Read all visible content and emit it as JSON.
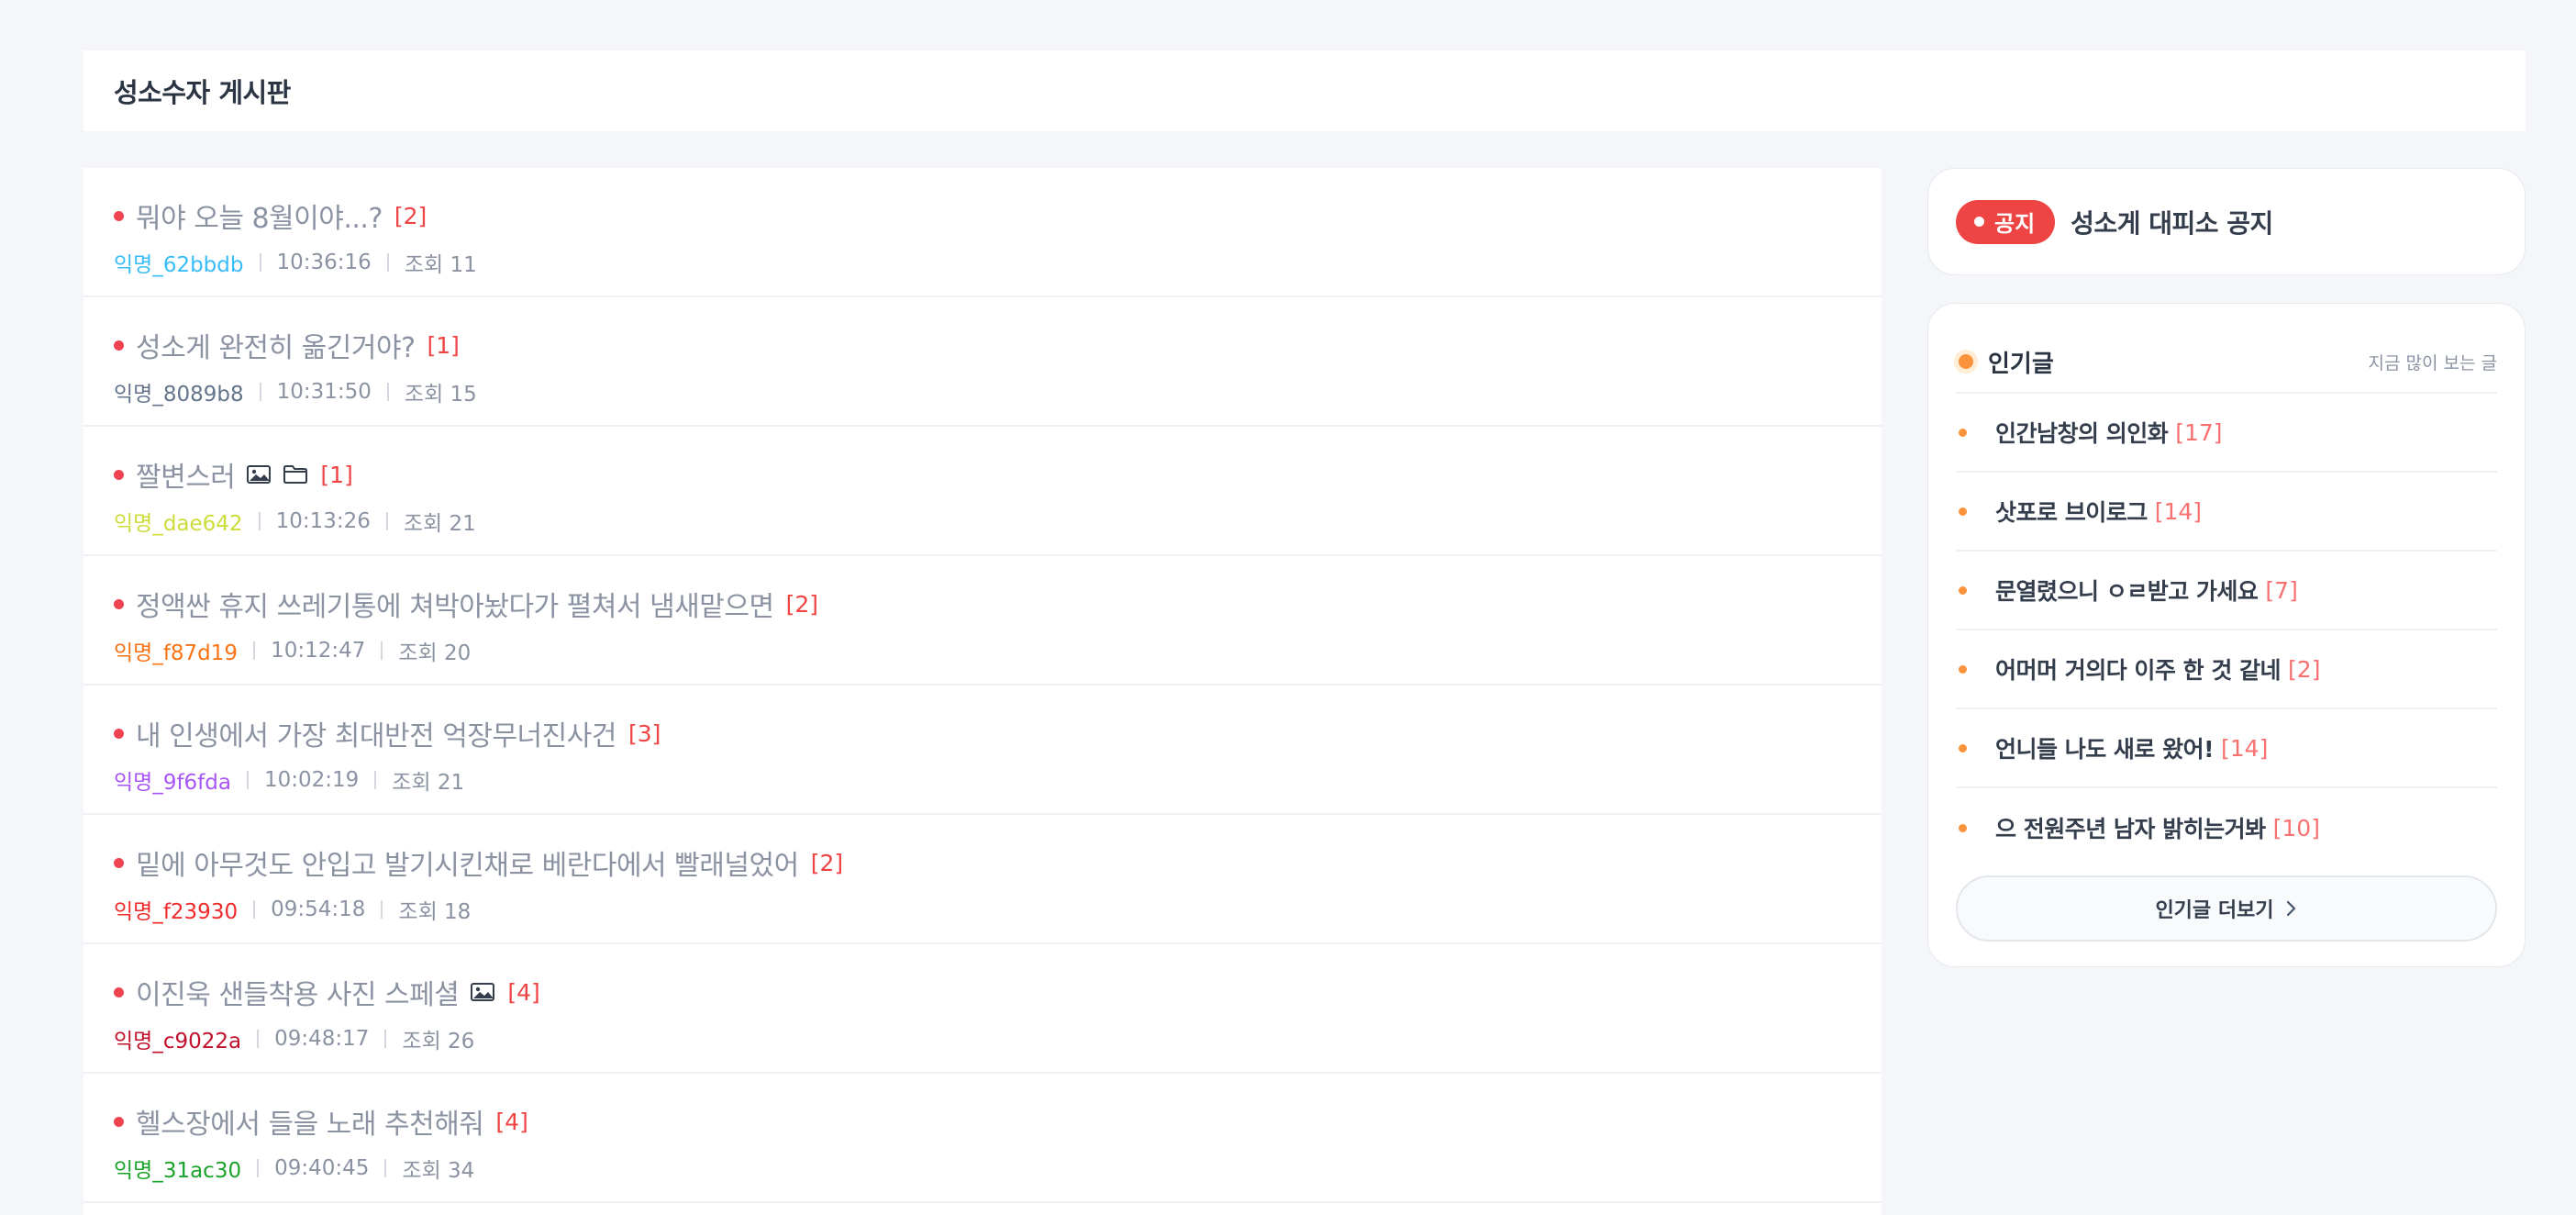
{
  "header": {
    "title": "성소수자 게시판"
  },
  "posts": [
    {
      "title": "뭐야 오늘 8월이야...?",
      "comments": "[2]",
      "author": "익명_62bbdb",
      "author_color": "#38bdf8",
      "time": "10:36:16",
      "views": "조회 11",
      "icons": []
    },
    {
      "title": "성소게 완전히 옮긴거야?",
      "comments": "[1]",
      "author": "익명_8089b8",
      "author_color": "#64748b",
      "time": "10:31:50",
      "views": "조회 15",
      "icons": []
    },
    {
      "title": "짤변스러",
      "comments": "[1]",
      "author": "익명_dae642",
      "author_color": "#cddc39",
      "time": "10:13:26",
      "views": "조회 21",
      "icons": [
        "image-icon",
        "folder-icon"
      ]
    },
    {
      "title": "정액싼 휴지 쓰레기통에 쳐박아놨다가 펼쳐서 냄새맡으면",
      "comments": "[2]",
      "author": "익명_f87d19",
      "author_color": "#f97316",
      "time": "10:12:47",
      "views": "조회 20",
      "icons": []
    },
    {
      "title": "내 인생에서 가장 최대반전 억장무너진사건",
      "comments": "[3]",
      "author": "익명_9f6fda",
      "author_color": "#a855f7",
      "time": "10:02:19",
      "views": "조회 21",
      "icons": []
    },
    {
      "title": "밑에 아무것도 안입고 발기시킨채로 베란다에서 빨래널었어",
      "comments": "[2]",
      "author": "익명_f23930",
      "author_color": "#ef2b2b",
      "time": "09:54:18",
      "views": "조회 18",
      "icons": []
    },
    {
      "title": "이진욱 샌들착용 사진 스페셜",
      "comments": "[4]",
      "author": "익명_c9022a",
      "author_color": "#c0102c",
      "time": "09:48:17",
      "views": "조회 26",
      "icons": [
        "image-icon"
      ]
    },
    {
      "title": "헬스장에서 들을 노래 추천해줘",
      "comments": "[4]",
      "author": "익명_31ac30",
      "author_color": "#1aa32a",
      "time": "09:40:45",
      "views": "조회 34",
      "icons": []
    }
  ],
  "notice": {
    "badge": "공지",
    "text": "성소게 대피소 공지"
  },
  "popular": {
    "title": "인기글",
    "subtitle": "지금 많이 보는 글",
    "items": [
      {
        "title": "인간남창의 의인화",
        "comments": "[17]"
      },
      {
        "title": "삿포로 브이로그",
        "comments": "[14]"
      },
      {
        "title": "문열렸으니 ㅇㄹ받고 가세요",
        "comments": "[7]"
      },
      {
        "title": "어머머 거의다 이주 한 것 같네",
        "comments": "[2]"
      },
      {
        "title": "언니들 나도 새로 왔어!",
        "comments": "[14]"
      },
      {
        "title": "으 전원주년 남자 밝히는거봐",
        "comments": "[10]"
      }
    ],
    "more_label": "인기글 더보기"
  }
}
